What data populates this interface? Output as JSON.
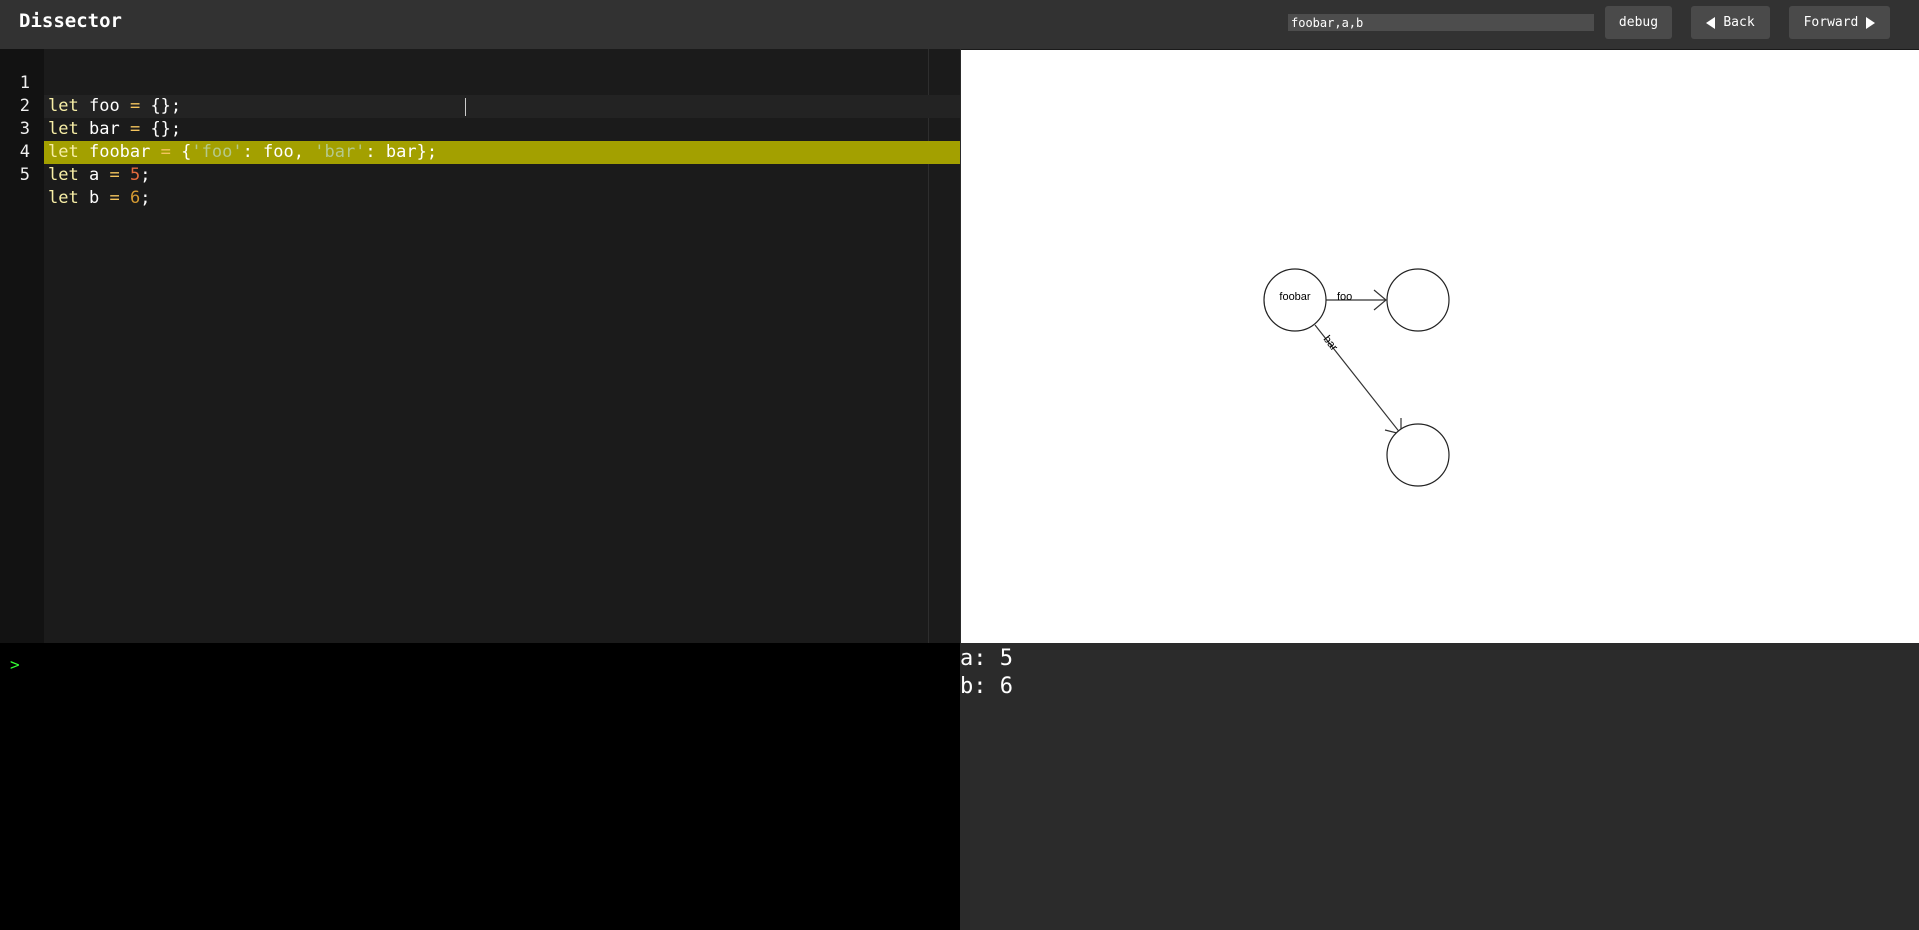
{
  "app": {
    "title": "Dissector"
  },
  "header": {
    "watch_value": "foobar,a,b",
    "debug_label": "debug",
    "back_label": "Back",
    "forward_label": "Forward"
  },
  "editor": {
    "lines": [
      {
        "num": "1",
        "tokens": [
          "let",
          "foo",
          "=",
          "{};"
        ]
      },
      {
        "num": "2",
        "tokens": [
          "let",
          "bar",
          "=",
          "{};"
        ]
      },
      {
        "num": "3",
        "tokens": [
          "let",
          "foobar",
          "=",
          "{",
          "'foo'",
          ": foo, ",
          "'bar'",
          ": bar};"
        ]
      },
      {
        "num": "4",
        "tokens": [
          "let",
          "a",
          "=",
          "5",
          ";"
        ]
      },
      {
        "num": "5",
        "tokens": [
          "let",
          "b",
          "=",
          "6",
          ";"
        ]
      }
    ],
    "highlighted_line": "5"
  },
  "graph": {
    "nodes": [
      {
        "id": "foobar",
        "label": "foobar"
      },
      {
        "id": "foo",
        "label": ""
      },
      {
        "id": "bar",
        "label": ""
      }
    ],
    "edges": [
      {
        "from": "foobar",
        "to": "foo",
        "label": "foo"
      },
      {
        "from": "foobar",
        "to": "bar",
        "label": "bar"
      }
    ]
  },
  "console": {
    "prompt": ">"
  },
  "variables": [
    {
      "text": "a: 5"
    },
    {
      "text": "b: 6"
    }
  ],
  "colors": {
    "highlight_line": "#a3a000",
    "keyword": "#f7eea6",
    "operator": "#f4c45e",
    "string": "#b5c98a",
    "number": "#e46a3c",
    "prompt": "#33ff33"
  }
}
